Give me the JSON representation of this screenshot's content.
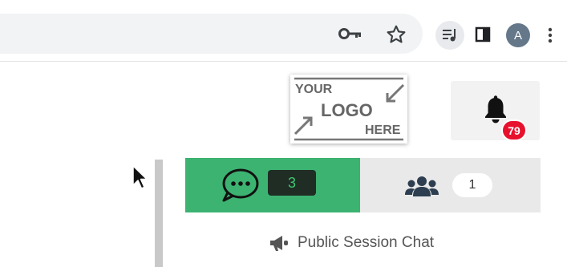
{
  "browser": {
    "profile_initial": "A",
    "icons": [
      "key-icon",
      "star-icon",
      "media-control-icon",
      "side-panel-icon",
      "kebab-menu-icon"
    ]
  },
  "logo": {
    "line1": "YOUR",
    "line2": "LOGO",
    "line3": "HERE"
  },
  "notifications": {
    "count": "79",
    "badge_color": "#e8112d"
  },
  "tabs": {
    "chat": {
      "count": "3",
      "color": "#3cb371",
      "active": true
    },
    "participants": {
      "count": "1",
      "color": "#e9e9e9",
      "active": false
    }
  },
  "session": {
    "title": "Public Session Chat"
  }
}
